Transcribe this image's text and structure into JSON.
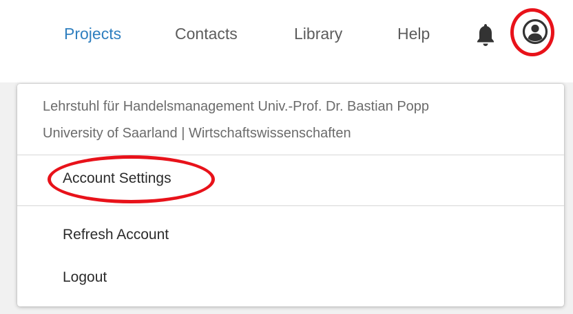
{
  "nav": {
    "items": [
      {
        "label": "Projects",
        "active": true
      },
      {
        "label": "Contacts",
        "active": false
      },
      {
        "label": "Library",
        "active": false
      },
      {
        "label": "Help",
        "active": false
      }
    ],
    "notification_icon": "bell-icon",
    "account_icon": "user-circle-icon",
    "active_color": "#2f7fbf"
  },
  "dropdown": {
    "org_name": "Lehrstuhl für Handelsmanagement Univ.-Prof. Dr. Bastian Popp",
    "org_detail": "University of Saarland | Wirtschaftswissenschaften",
    "items": [
      {
        "label": "Account Settings"
      },
      {
        "label": "Refresh Account"
      },
      {
        "label": "Logout"
      }
    ]
  },
  "annotation": {
    "highlight_color": "#e8121a"
  }
}
